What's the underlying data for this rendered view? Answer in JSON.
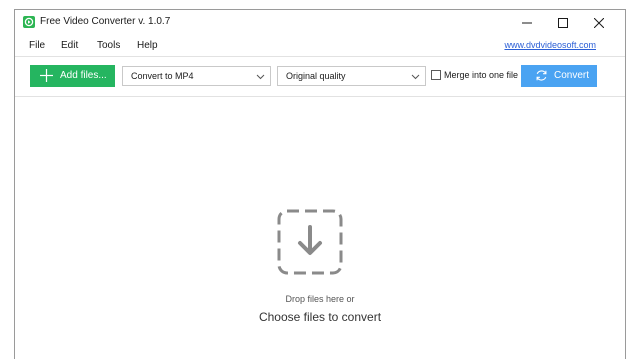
{
  "window": {
    "title": "Free Video Converter v. 1.0.7"
  },
  "menu": {
    "items": [
      "File",
      "Edit",
      "Tools",
      "Help"
    ],
    "site_link": "www.dvdvideosoft.com"
  },
  "toolbar": {
    "add_files_label": "Add files...",
    "format_value": "Convert to MP4",
    "quality_value": "Original quality",
    "merge_label": "Merge into one file",
    "merge_checked": false,
    "convert_label": "Convert"
  },
  "drop_zone": {
    "hint": "Drop files here or",
    "choose_label": "Choose files to convert"
  },
  "colors": {
    "add_button": "#25b560",
    "convert_button": "#4aa3f2",
    "link": "#2b5fd6",
    "drop_icon": "#8a8a8a"
  },
  "icons": {
    "app": "app-logo-icon",
    "add": "plus-icon",
    "convert": "refresh-icon",
    "drop": "download-arrow-icon"
  }
}
